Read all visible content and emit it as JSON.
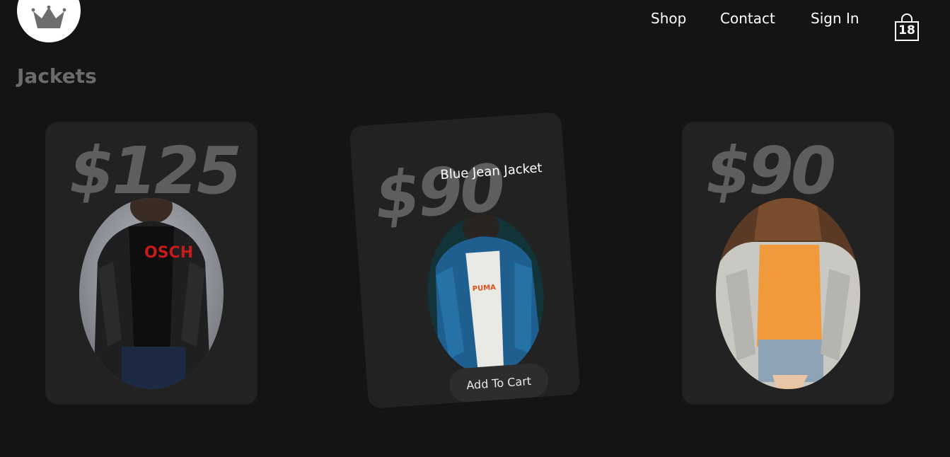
{
  "nav": {
    "shop": "Shop",
    "contact": "Contact",
    "sign_in": "Sign In",
    "cart_count": "18"
  },
  "section": {
    "title": "Jackets"
  },
  "products": [
    {
      "price": "$125",
      "image": "man-in-black-denim-jacket"
    },
    {
      "price": "$90",
      "name": "Blue Jean Jacket",
      "cta": "Add To Cart",
      "image": "man-in-blue-denim-jacket"
    },
    {
      "price": "$90",
      "image": "woman-in-light-denim-jacket"
    }
  ],
  "colors": {
    "background": "#141414",
    "card": "#222222",
    "price_text": "#5e5e5e",
    "title_text": "#6b6b6b",
    "nav_text": "#ffffff"
  }
}
